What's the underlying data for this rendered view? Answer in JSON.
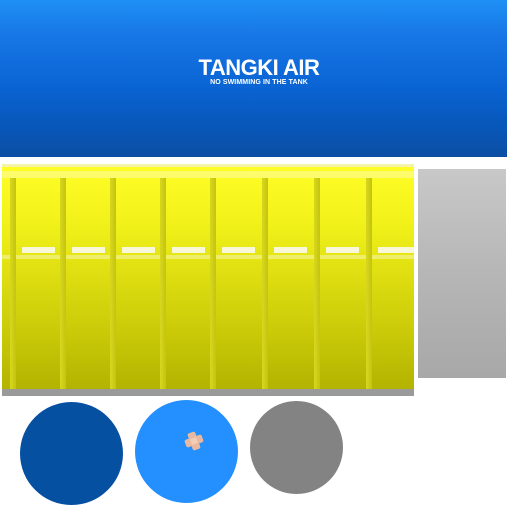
{
  "banner": {
    "title": "TANGKI AIR",
    "subtitle": "NO SWIMMING IN THE TANK"
  },
  "colors": {
    "banner_blue": "#0a64d4",
    "crate_yellow": "#dcdc10",
    "panel_grey": "#b6b6b6",
    "button_dark_blue": "#0650a2",
    "button_light_blue": "#2490ff",
    "button_grey": "#838383",
    "bandage": "#e8b9a0"
  },
  "icons": {
    "bandage": "bandage-icon"
  }
}
